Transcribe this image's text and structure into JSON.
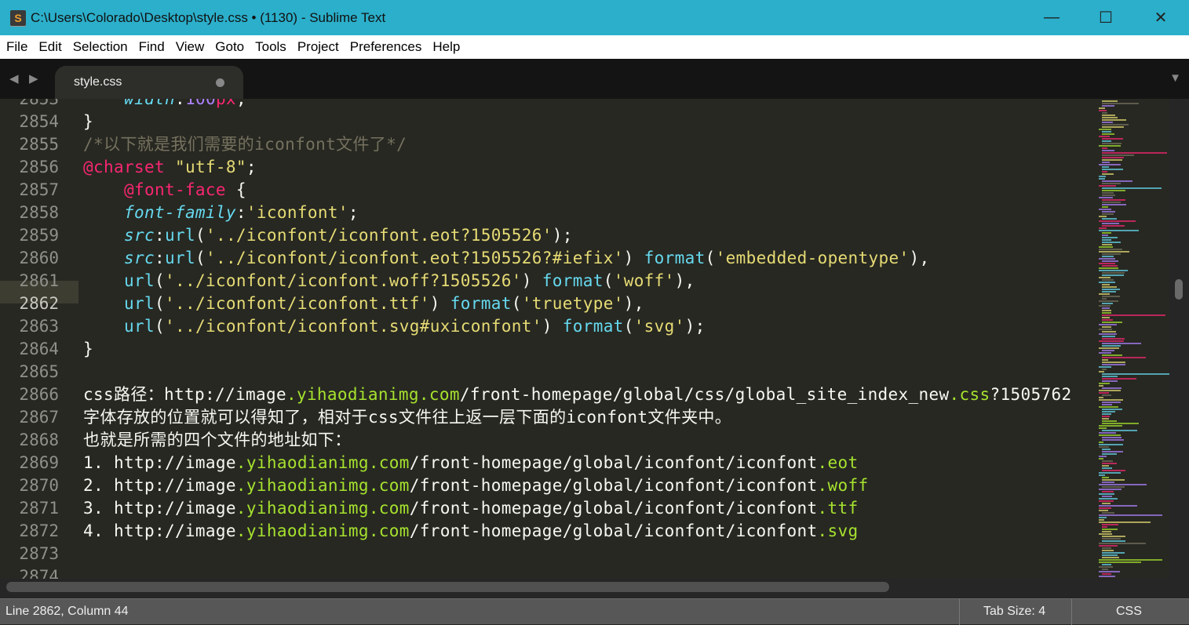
{
  "window": {
    "title": "C:\\Users\\Colorado\\Desktop\\style.css • (1130) - Sublime Text",
    "app_icon": "S",
    "minimize": "—",
    "maximize": "☐",
    "close": "✕"
  },
  "menu": [
    "File",
    "Edit",
    "Selection",
    "Find",
    "View",
    "Goto",
    "Tools",
    "Project",
    "Preferences",
    "Help"
  ],
  "tabs": [
    {
      "label": "style.css",
      "dirty": true
    }
  ],
  "colors": {
    "bg": "#272822",
    "comment": "#75715e",
    "keyword": "#f92672",
    "string": "#e6db74",
    "support": "#66d9ef",
    "number": "#ae81ff",
    "green": "#a6e22e",
    "text": "#f8f8f2",
    "titlebar": "#2bafcb"
  },
  "editor": {
    "current_line": 2862,
    "lines": [
      {
        "n": "2853",
        "tokens": [
          {
            "t": "    "
          },
          {
            "t": "width",
            "c": "support",
            "i": true
          },
          {
            "t": ":"
          },
          {
            "t": "100",
            "c": "number"
          },
          {
            "t": "px",
            "c": "keyword"
          },
          {
            "t": ";"
          }
        ]
      },
      {
        "n": "2854",
        "tokens": [
          {
            "t": "}"
          }
        ]
      },
      {
        "n": "2855",
        "tokens": [
          {
            "t": "/*以下就是我们需要的iconfont文件了*/",
            "c": "comment"
          }
        ]
      },
      {
        "n": "2856",
        "tokens": [
          {
            "t": "@charset",
            "c": "keyword"
          },
          {
            "t": " "
          },
          {
            "t": "\"utf-8\"",
            "c": "string"
          },
          {
            "t": ";"
          }
        ]
      },
      {
        "n": "2857",
        "tokens": [
          {
            "t": "    "
          },
          {
            "t": "@font-face",
            "c": "keyword"
          },
          {
            "t": " {"
          }
        ]
      },
      {
        "n": "2858",
        "tokens": [
          {
            "t": "    "
          },
          {
            "t": "font-family",
            "c": "support",
            "i": true
          },
          {
            "t": ":"
          },
          {
            "t": "'iconfont'",
            "c": "string"
          },
          {
            "t": ";"
          }
        ]
      },
      {
        "n": "2859",
        "tokens": [
          {
            "t": "    "
          },
          {
            "t": "src",
            "c": "support",
            "i": true
          },
          {
            "t": ":"
          },
          {
            "t": "url",
            "c": "support"
          },
          {
            "t": "("
          },
          {
            "t": "'../iconfont/iconfont.eot?1505526'",
            "c": "string"
          },
          {
            "t": ");"
          }
        ]
      },
      {
        "n": "2860",
        "tokens": [
          {
            "t": "    "
          },
          {
            "t": "src",
            "c": "support",
            "i": true
          },
          {
            "t": ":"
          },
          {
            "t": "url",
            "c": "support"
          },
          {
            "t": "("
          },
          {
            "t": "'../iconfont/iconfont.eot?1505526?#iefix'",
            "c": "string"
          },
          {
            "t": ") "
          },
          {
            "t": "format",
            "c": "support"
          },
          {
            "t": "("
          },
          {
            "t": "'embedded-opentype'",
            "c": "string"
          },
          {
            "t": "),"
          }
        ]
      },
      {
        "n": "2861",
        "tokens": [
          {
            "t": "    "
          },
          {
            "t": "url",
            "c": "support"
          },
          {
            "t": "("
          },
          {
            "t": "'../iconfont/iconfont.woff?1505526'",
            "c": "string"
          },
          {
            "t": ") "
          },
          {
            "t": "format",
            "c": "support"
          },
          {
            "t": "("
          },
          {
            "t": "'woff'",
            "c": "string"
          },
          {
            "t": "),"
          }
        ]
      },
      {
        "n": "2862",
        "tokens": [
          {
            "t": "    "
          },
          {
            "t": "url",
            "c": "support"
          },
          {
            "t": "("
          },
          {
            "t": "'../iconfont/iconfont.ttf'",
            "c": "string"
          },
          {
            "t": ") "
          },
          {
            "t": "format",
            "c": "support"
          },
          {
            "t": "("
          },
          {
            "t": "'truetype'",
            "c": "string"
          },
          {
            "t": "),"
          }
        ]
      },
      {
        "n": "2863",
        "tokens": [
          {
            "t": "    "
          },
          {
            "t": "url",
            "c": "support"
          },
          {
            "t": "("
          },
          {
            "t": "'../iconfont/iconfont.svg#uxiconfont'",
            "c": "string"
          },
          {
            "t": ") "
          },
          {
            "t": "format",
            "c": "support"
          },
          {
            "t": "("
          },
          {
            "t": "'svg'",
            "c": "string"
          },
          {
            "t": ");"
          }
        ]
      },
      {
        "n": "2864",
        "tokens": [
          {
            "t": "}"
          }
        ]
      },
      {
        "n": "2865",
        "tokens": []
      },
      {
        "n": "2866",
        "tokens": [
          {
            "t": "css路径：http://image"
          },
          {
            "t": ".yihaodianimg.com",
            "c": "green"
          },
          {
            "t": "/front-homepage/global/css/global_site_index_new"
          },
          {
            "t": ".css",
            "c": "green"
          },
          {
            "t": "?1505762"
          }
        ]
      },
      {
        "n": "2867",
        "tokens": [
          {
            "t": "字体存放的位置就可以得知了，相对于css文件往上返一层下面的iconfont文件夹中。"
          }
        ]
      },
      {
        "n": "2868",
        "tokens": [
          {
            "t": "也就是所需的四个文件的地址如下："
          }
        ]
      },
      {
        "n": "2869",
        "tokens": [
          {
            "t": "1. http://image"
          },
          {
            "t": ".yihaodianimg.com",
            "c": "green"
          },
          {
            "t": "/front-homepage/global/iconfont/iconfont"
          },
          {
            "t": ".eot",
            "c": "green"
          }
        ]
      },
      {
        "n": "2870",
        "tokens": [
          {
            "t": "2. http://image"
          },
          {
            "t": ".yihaodianimg.com",
            "c": "green"
          },
          {
            "t": "/front-homepage/global/iconfont/iconfont"
          },
          {
            "t": ".woff",
            "c": "green"
          }
        ]
      },
      {
        "n": "2871",
        "tokens": [
          {
            "t": "3. http://image"
          },
          {
            "t": ".yihaodianimg.com",
            "c": "green"
          },
          {
            "t": "/front-homepage/global/iconfont/iconfont"
          },
          {
            "t": ".ttf",
            "c": "green"
          }
        ]
      },
      {
        "n": "2872",
        "tokens": [
          {
            "t": "4. http://image"
          },
          {
            "t": ".yihaodianimg.com",
            "c": "green"
          },
          {
            "t": "/front-homepage/global/iconfont/iconfont"
          },
          {
            "t": ".svg",
            "c": "green"
          }
        ]
      },
      {
        "n": "2873",
        "tokens": []
      },
      {
        "n": "2874",
        "tokens": []
      }
    ]
  },
  "status": {
    "position": "Line 2862, Column 44",
    "tab_size": "Tab Size: 4",
    "syntax": "CSS"
  }
}
